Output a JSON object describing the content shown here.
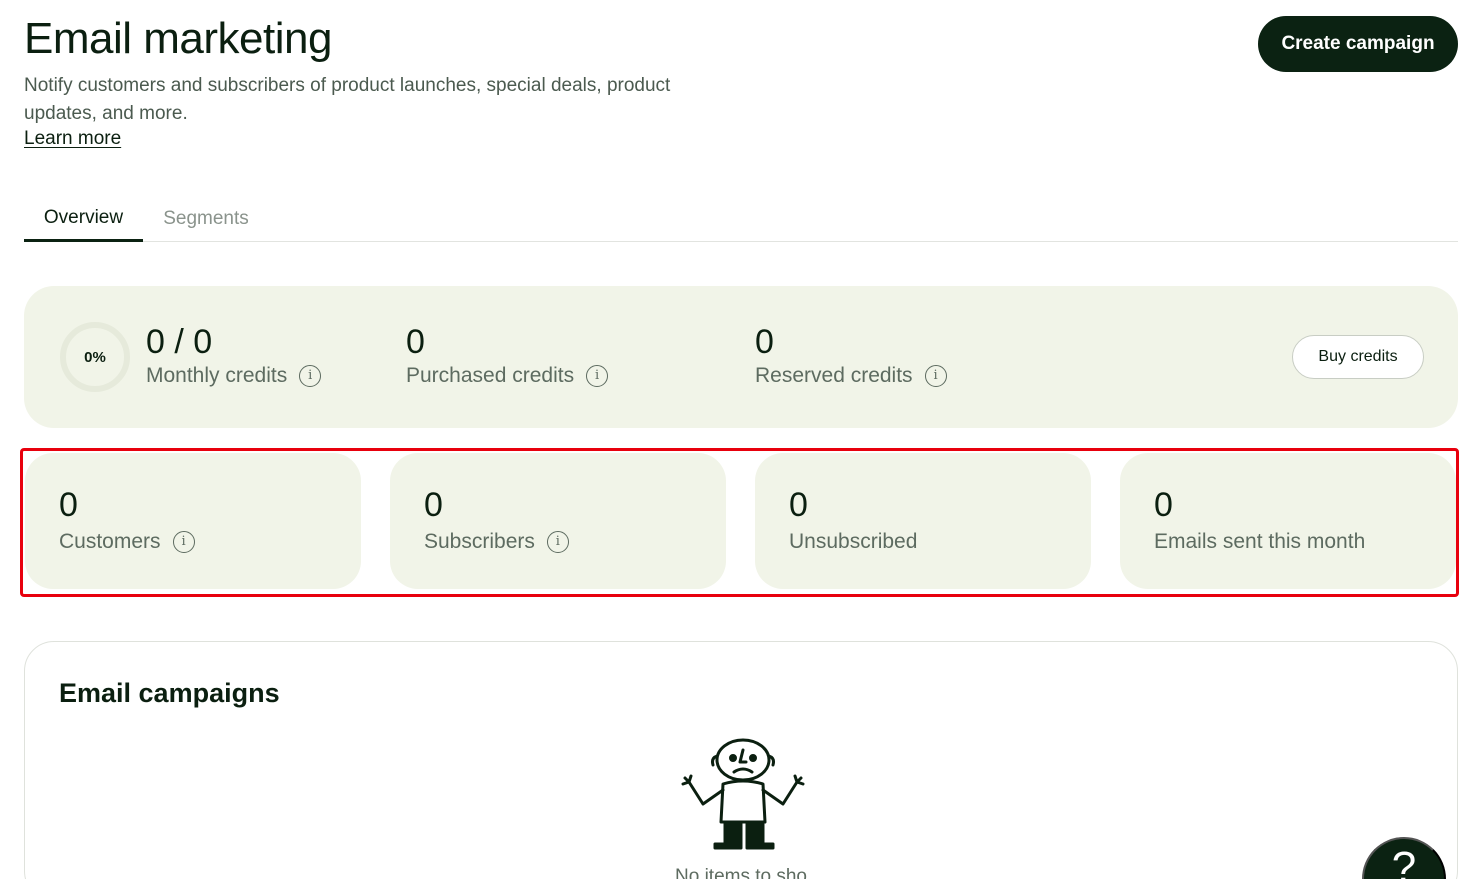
{
  "header": {
    "title": "Email marketing",
    "subtitle": "Notify customers and subscribers of product launches, special deals, product updates, and more.",
    "learn_more": "Learn more",
    "create_button": "Create campaign"
  },
  "tabs": [
    {
      "label": "Overview",
      "active": true
    },
    {
      "label": "Segments",
      "active": false
    }
  ],
  "credits": {
    "progress_label": "0%",
    "progress_fraction": 0,
    "monthly": {
      "value": "0 / 0",
      "label": "Monthly credits"
    },
    "purchased": {
      "value": "0",
      "label": "Purchased credits"
    },
    "reserved": {
      "value": "0",
      "label": "Reserved credits"
    },
    "buy_button": "Buy credits"
  },
  "metrics": [
    {
      "value": "0",
      "label": "Customers",
      "info": true
    },
    {
      "value": "0",
      "label": "Subscribers",
      "info": true
    },
    {
      "value": "0",
      "label": "Unsubscribed",
      "info": false
    },
    {
      "value": "0",
      "label": "Emails sent this month",
      "info": false
    }
  ],
  "campaigns": {
    "title": "Email campaigns",
    "empty_text": "No items to sho"
  },
  "help_button": "?",
  "icons": {
    "info": "info-icon",
    "illustration": "shrugging-person-illustration"
  },
  "colors": {
    "brand_dark": "#0b2212",
    "panel_bg": "#f1f4e8",
    "highlight": "#e8000d"
  }
}
